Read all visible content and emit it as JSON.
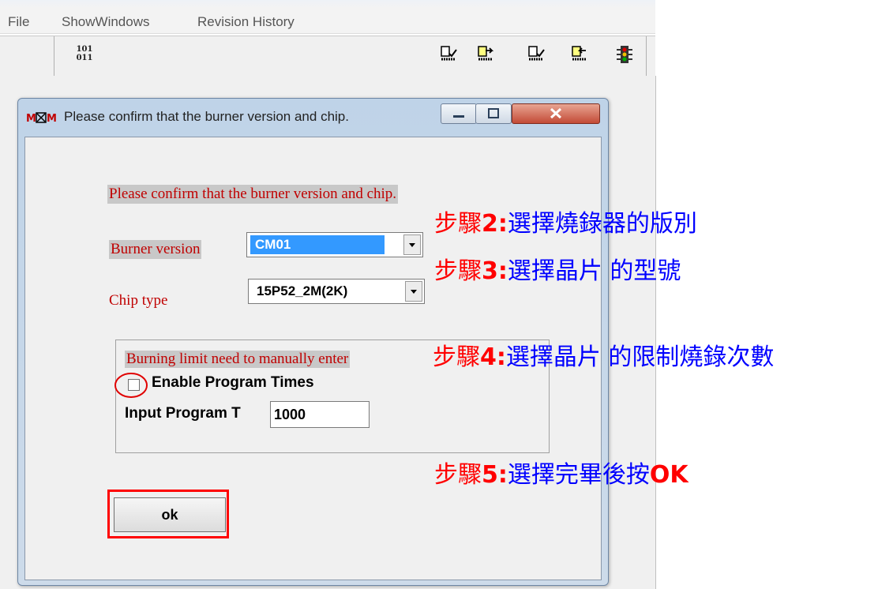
{
  "menubar": {
    "items": [
      "File",
      "ShowWindows",
      "Revision History"
    ]
  },
  "toolbar": {
    "binary_icon_text_top": "101",
    "binary_icon_text_bottom": "011",
    "icons": [
      "program-check-icon",
      "program-forward-icon",
      "verify-check-icon",
      "program-back-icon",
      "traffic-light-icon"
    ]
  },
  "dialog": {
    "title": "Please confirm that the burner version and chip.",
    "heading": "Please confirm that the burner version and chip.",
    "burner_label": "Burner version",
    "burner_value": "CM01",
    "chip_label": "Chip type",
    "chip_value": "15P52_2M(2K)",
    "group_title": "Burning limit need to manually enter",
    "enable_label": "Enable Program Times",
    "input_label": "Input Program T",
    "input_value": "1000",
    "ok_label": "ok"
  },
  "annotations": {
    "step2": {
      "prefix": "步驟",
      "num": "2:",
      "text": "選擇燒錄器的版別"
    },
    "step3": {
      "prefix": "步驟",
      "num": "3:",
      "text": "選擇晶片 的型號"
    },
    "step4": {
      "prefix": "步驟",
      "num": "4:",
      "text": "選擇晶片 的限制燒錄次數"
    },
    "step5": {
      "prefix": "步驟",
      "num": "5:",
      "text": "選擇完畢後按",
      "suffix": "OK"
    }
  },
  "colors": {
    "annotation_blue": "#0000ff",
    "annotation_red": "#ff0000",
    "label_red": "#c00000",
    "selection_blue": "#3399ff"
  }
}
